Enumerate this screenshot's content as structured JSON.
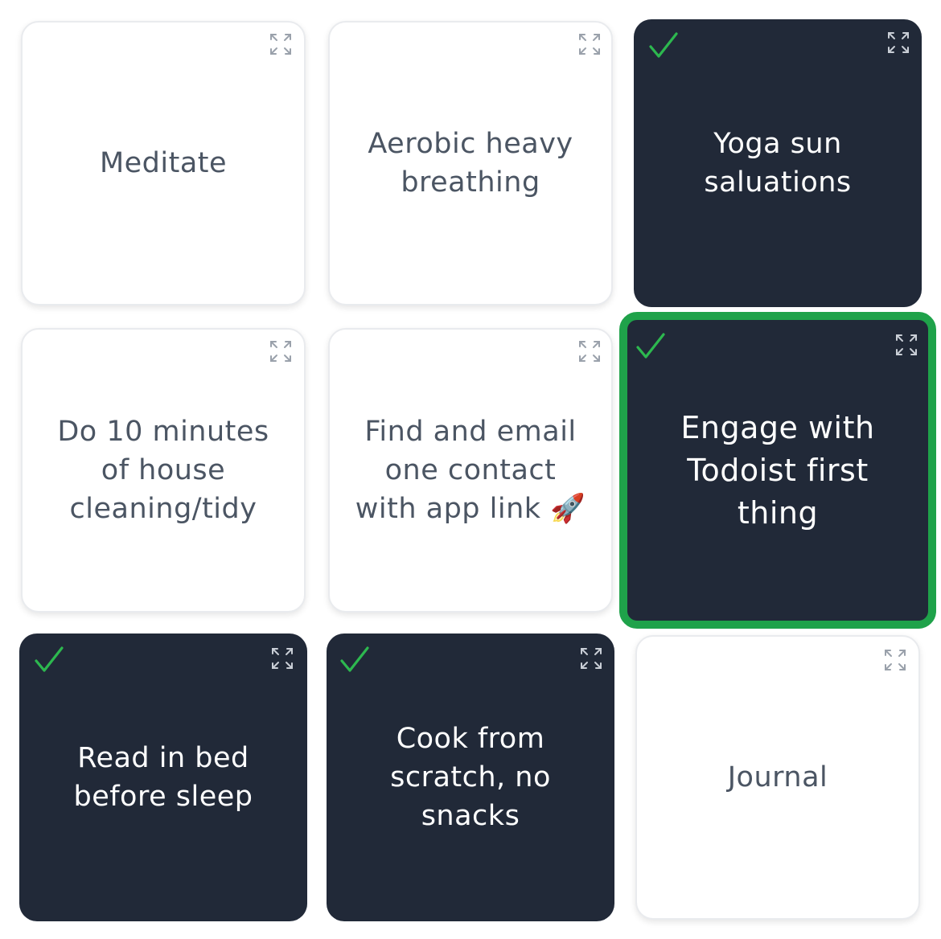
{
  "colors": {
    "tile_dark": "#212938",
    "tile_light": "#ffffff",
    "text_light_tile": "#4b5563",
    "check": "#2db84f",
    "selected_border": "#1fa24a",
    "icon_light": "#9aa1ab",
    "icon_dark": "#c9ced6"
  },
  "tiles": [
    {
      "label": "Meditate",
      "completed": false,
      "selected": false,
      "icon": "expand-icon"
    },
    {
      "label": "Aerobic heavy breathing",
      "completed": false,
      "selected": false,
      "icon": "expand-icon"
    },
    {
      "label": "Yoga sun saluations",
      "completed": true,
      "selected": false,
      "icon": "expand-icon"
    },
    {
      "label": "Do 10 minutes of house cleaning/tidy",
      "completed": false,
      "selected": false,
      "icon": "expand-icon"
    },
    {
      "label": "Find and email one contact with app link 🚀",
      "completed": false,
      "selected": false,
      "icon": "expand-icon"
    },
    {
      "label": "Engage with Todoist first thing",
      "completed": true,
      "selected": true,
      "icon": "expand-icon"
    },
    {
      "label": "Read in bed before sleep",
      "completed": true,
      "selected": false,
      "icon": "expand-icon"
    },
    {
      "label": "Cook from scratch, no snacks",
      "completed": true,
      "selected": false,
      "icon": "expand-icon"
    },
    {
      "label": "Journal",
      "completed": false,
      "selected": false,
      "icon": "expand-icon"
    }
  ]
}
